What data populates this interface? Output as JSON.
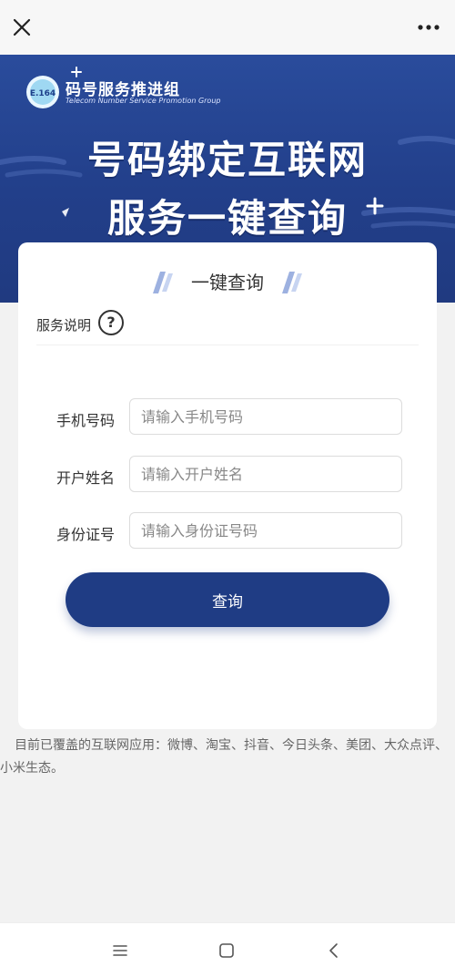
{
  "topbar": {
    "close_icon": "close-icon",
    "more_icon": "more-icon"
  },
  "banner": {
    "logo_badge": "E.164",
    "logo_title": "码号服务推进组",
    "logo_subtitle": "Telecom Number Service Promotion Group",
    "headline_line1": "号码绑定互联网",
    "headline_line2": "服务一键查询",
    "colors": {
      "banner": "#223f8a",
      "primary": "#1f3c84"
    }
  },
  "card": {
    "title": "一键查询",
    "service_label": "服务说明",
    "help_icon_text": "?",
    "form": {
      "phone": {
        "label": "手机号码",
        "placeholder": "请输入手机号码",
        "value": ""
      },
      "name": {
        "label": "开户姓名",
        "placeholder": "请输入开户姓名",
        "value": ""
      },
      "id": {
        "label": "身份证号",
        "placeholder": "请输入身份证号码",
        "value": ""
      }
    },
    "query_button": "查询"
  },
  "coverage_text": "目前已覆盖的互联网应用：微博、淘宝、抖音、今日头条、美团、大众点评、小米生态。",
  "navbar": {
    "menu_icon": "menu-icon",
    "home_icon": "home-icon",
    "back_icon": "back-icon"
  }
}
